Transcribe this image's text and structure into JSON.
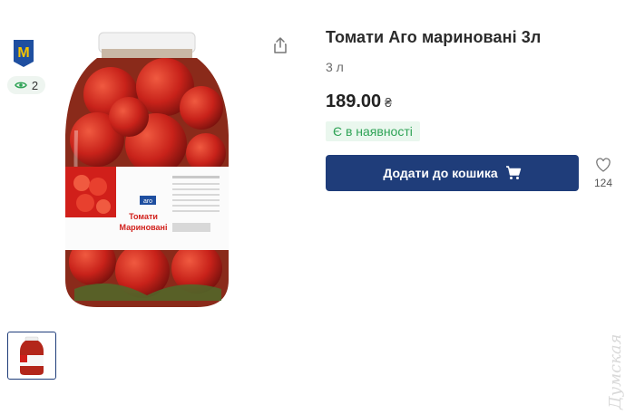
{
  "store": {
    "logo_letter": "M",
    "logo_name": "store-logo-icon"
  },
  "views": {
    "icon": "eye-icon",
    "count": "2"
  },
  "product": {
    "title": "Томати Аго мариновані 3л",
    "volume": "3 л",
    "price": "189.00",
    "currency": "₴",
    "availability": "Є в наявності",
    "label_brand": "aro",
    "label_line1": "Томати",
    "label_line2": "Мариновані"
  },
  "actions": {
    "add_to_cart": "Додати до кошика",
    "cart_icon": "cart-icon",
    "share_icon": "share-icon",
    "wishlist_icon": "heart-icon",
    "wishlist_count": "124"
  },
  "gallery": {
    "thumbnails": 1,
    "selected": 1
  },
  "watermark": "Думская",
  "colors": {
    "primary": "#1f3d7a",
    "stock_green": "#2fa356",
    "stock_bg": "#eaf7ee",
    "logo_yellow": "#f5c400",
    "logo_blue": "#1f4fa0"
  }
}
